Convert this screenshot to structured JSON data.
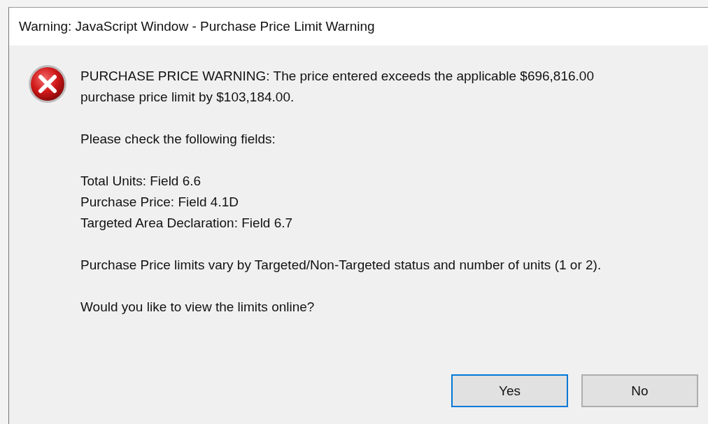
{
  "window": {
    "title": "Warning: JavaScript Window - Purchase Price Limit Warning"
  },
  "message": {
    "kind": "error",
    "paragraphs": [
      [
        "PURCHASE PRICE WARNING: The price entered exceeds the applicable $696,816.00",
        "purchase price limit by $103,184.00."
      ],
      [
        "Please check the following fields:"
      ],
      [
        "Total Units: Field 6.6",
        "Purchase Price: Field 4.1D",
        "Targeted Area Declaration: Field 6.7"
      ],
      [
        "Purchase Price limits vary by Targeted/Non-Targeted status and number of units (1 or 2)."
      ],
      [
        "Would you like to view the limits online?"
      ]
    ]
  },
  "buttons": [
    {
      "label": "Yes",
      "selected": true
    },
    {
      "label": "No",
      "selected": false
    }
  ]
}
